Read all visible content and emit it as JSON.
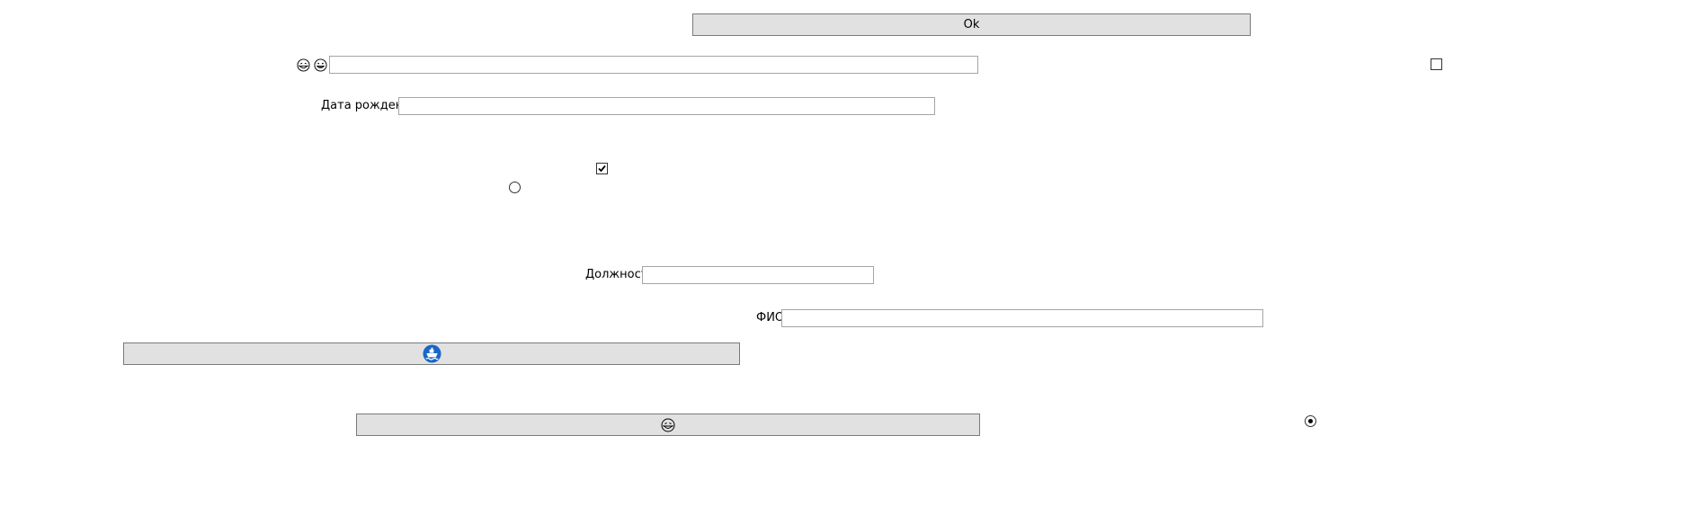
{
  "ok_button": {
    "label": "Ok"
  },
  "top_field": {
    "value": ""
  },
  "birth_date": {
    "label": "Дата рождения",
    "value": ""
  },
  "position": {
    "label": "Должность",
    "value": ""
  },
  "full_name": {
    "label": "ФИО",
    "value": ""
  },
  "checkbox_top_right": {
    "checked": false
  },
  "checkbox_middle": {
    "checked": true
  },
  "radio_left": {
    "selected": false
  },
  "radio_right": {
    "selected": true
  },
  "icons": {
    "emoji_1": "laughing-face-icon",
    "emoji_2": "grinning-face-icon",
    "ship_button_icon": "ship-icon",
    "emoji_button_icon": "laughing-face-icon"
  },
  "colors": {
    "button_bg": "#e1e1e1",
    "ship_icon_blue": "#1a66c8"
  }
}
